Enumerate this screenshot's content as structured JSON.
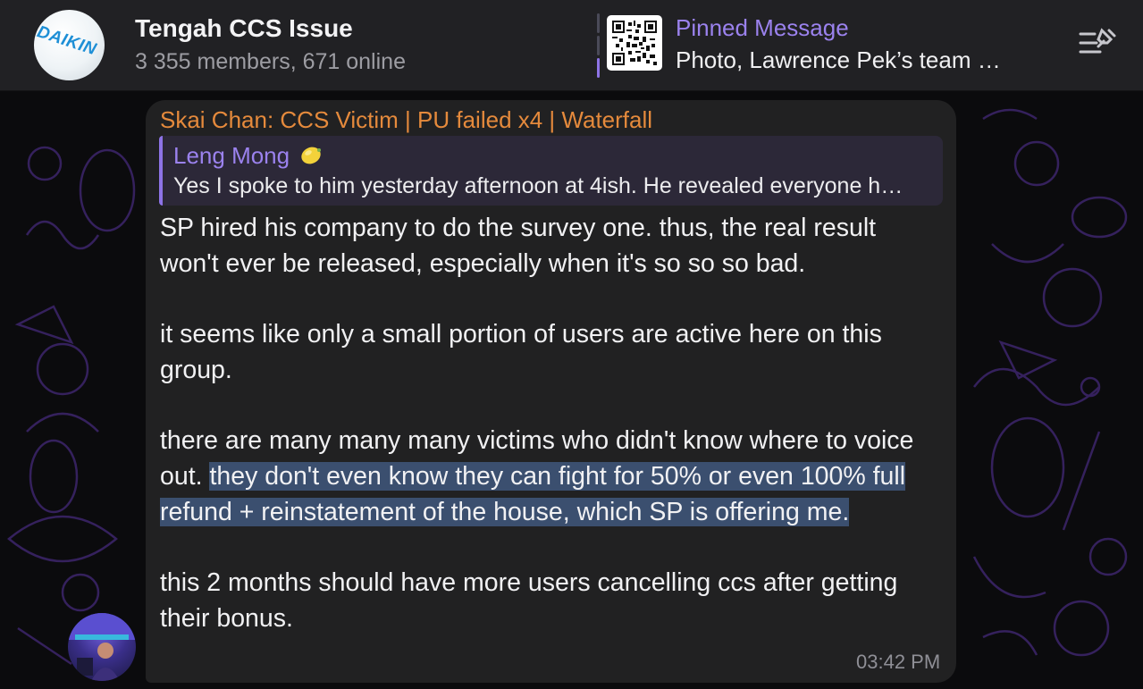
{
  "header": {
    "group_name": "Tengah CCS Issue",
    "member_info": "3 355 members, 671 online",
    "avatar_text": "DAIKIN",
    "pinned": {
      "title": "Pinned Message",
      "text": "Photo, Lawrence Pek’s team h…"
    }
  },
  "message": {
    "sender": "Skai Chan: CCS Victim | PU failed x4 | Waterfall",
    "reply": {
      "name": "Leng Mong",
      "text": "Yes I spoke to him yesterday afternoon at 4ish. He revealed everyone h…"
    },
    "p1": "SP hired his company to do the survey one. thus, the real result won't ever be released, especially when it's so so so bad.",
    "p2": "it seems like only a small portion of users are active here on this group.",
    "p3_plain": "there are many many many victims who didn't know where to voice out. ",
    "p3_highlighted": "they don't even know they can fight for 50% or even 100% full refund + reinstatement of the house, which SP is offering me.",
    "p4": "this 2 months should have more users cancelling ccs after getting their bonus.",
    "time": "03:42 PM"
  },
  "colors": {
    "accent": "#9b82ee",
    "sender": "#e58a3c",
    "bubble": "#212122",
    "highlight": "#3b4f6f"
  },
  "icons": [
    "pinned-list-icon",
    "lemon-emoji-icon",
    "qr-code-icon"
  ]
}
